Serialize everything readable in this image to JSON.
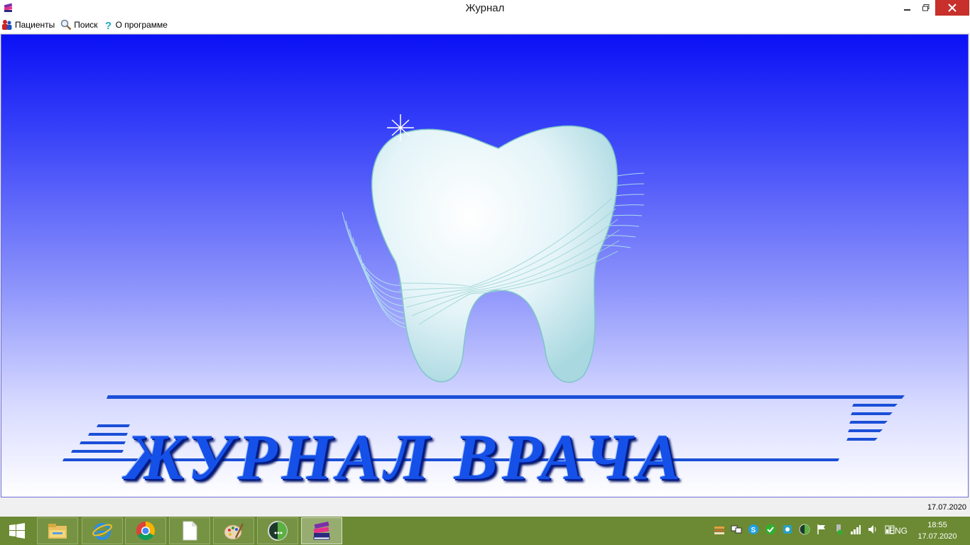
{
  "window": {
    "title": "Журнал"
  },
  "menu": {
    "items": [
      {
        "label": "Пациенты",
        "icon": "users-icon"
      },
      {
        "label": "Поиск",
        "icon": "magnifier-icon"
      },
      {
        "label": "О программе",
        "icon": "help-icon"
      }
    ]
  },
  "main": {
    "logo_text": "ЖУРНАЛ ВРАЧА",
    "image": "tooth-illustration"
  },
  "statusbar": {
    "date": "17.07.2020"
  },
  "taskbar": {
    "apps": [
      "file-explorer-icon",
      "internet-explorer-icon",
      "chrome-icon",
      "blank-document-icon",
      "paint-icon",
      "globe-app-icon",
      "journal-app-icon"
    ],
    "active_app": "journal-app-icon",
    "language": "ENG",
    "time": "18:55",
    "date": "17.07.2020",
    "colors": {
      "taskbar_bg": "#6b8a33",
      "close_btn": "#c7302b",
      "content_top": "#0a10f5",
      "logo_text": "#1550e8"
    }
  }
}
